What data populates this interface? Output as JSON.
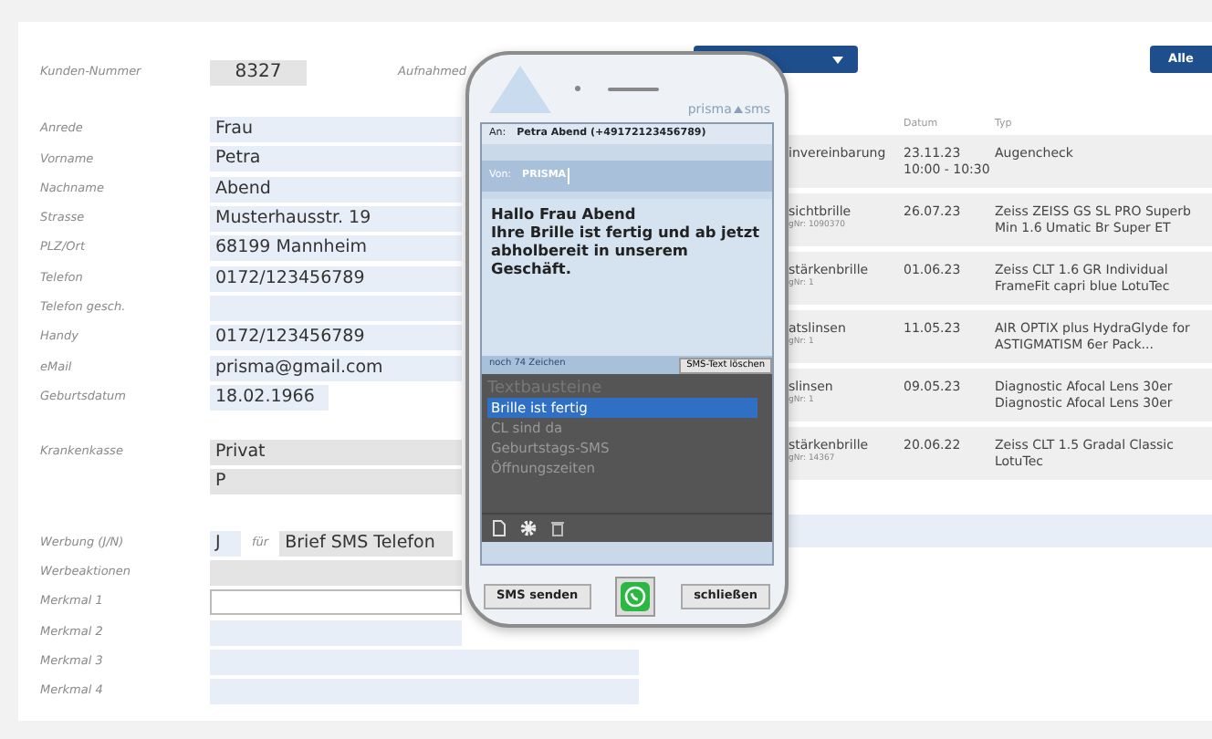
{
  "header": {
    "number_label": "Kunden-Nummer",
    "number": "8327",
    "intake_label": "Aufnahmed",
    "all_button": "Alle"
  },
  "form": {
    "groups": [
      [
        {
          "label": "Anrede",
          "value": "Frau",
          "kind": "text"
        },
        {
          "label": "Vorname",
          "value": "Petra",
          "kind": "text"
        },
        {
          "label": "Nachname",
          "value": "Abend",
          "kind": "text"
        },
        {
          "label": "Strasse",
          "value": "Musterhausstr. 19",
          "kind": "text"
        },
        {
          "label": "PLZ/Ort",
          "value": "68199 Mannheim",
          "kind": "text"
        },
        {
          "label": "Telefon",
          "value": "0172/123456789",
          "kind": "text"
        },
        {
          "label": "Telefon gesch.",
          "kind": "text"
        },
        {
          "label": "Handy",
          "value": "0172/123456789",
          "kind": "text"
        },
        {
          "label": "eMail",
          "value": "prisma@gmail.com",
          "kind": "text"
        },
        {
          "label": "Geburtsdatum",
          "value": "18.02.1966",
          "kind": "short"
        }
      ],
      [
        {
          "label": "Krankenkasse",
          "value": "Privat",
          "kind": "readonly"
        },
        {
          "value": "P",
          "kind": "readonly"
        }
      ],
      [
        {
          "label": "Werbung (J/N)",
          "value": "J",
          "kind": "optin",
          "for_label": "für",
          "channels": "Brief SMS Telefon"
        },
        {
          "label": "Werbeaktionen",
          "kind": "readonly"
        },
        {
          "label": "Merkmal 1",
          "kind": "input"
        },
        {
          "label": "Merkmal 2",
          "kind": "text"
        },
        {
          "label": "Merkmal 3",
          "kind": "long"
        },
        {
          "label": "Merkmal 4",
          "kind": "long"
        }
      ]
    ]
  },
  "table": {
    "columns": [
      "Datum",
      "Typ"
    ],
    "rows": [
      {
        "column_1": "invereinbarung",
        "date": "23.11.23",
        "time": "10:00 - 10:30",
        "type": "Augencheck"
      },
      {
        "column_1": "sichtbrille",
        "sub": "gNr: 1090370",
        "date": "26.07.23",
        "type": "Zeiss ZEISS GS SL PRO Superb Min 1.6 Umatic Br Super ET"
      },
      {
        "column_1": "stärkenbrille",
        "sub": "gNr: 1",
        "date": "01.06.23",
        "type": "Zeiss CLT 1.6 GR Individual FrameFit capri blue LotuTec"
      },
      {
        "column_1": "atslinsen",
        "sub": "gNr: 1",
        "date": "11.05.23",
        "type": "AIR OPTIX plus HydraGlyde for ASTIGMATISM 6er Pack..."
      },
      {
        "column_1": "slinsen",
        "sub": "gNr: 1",
        "date": "09.05.23",
        "type": "Diagnostic Afocal Lens 30er Diagnostic Afocal Lens 30er"
      },
      {
        "column_1": "stärkenbrille",
        "sub": "gNr: 14367",
        "date": "20.06.22",
        "type": "Zeiss CLT 1.5 Gradal Classic LotuTec"
      }
    ]
  },
  "phone": {
    "brand": "prisma",
    "brand_suffix": "sms",
    "to_label": "An:",
    "to": "Petra Abend (+49172123456789)",
    "from_label": "Von:",
    "from": "PRISMA",
    "message": "Hallo Frau Abend\nIhre Brille ist fertig und ab jetzt abholbereit in unserem Geschäft.",
    "chars_left": "noch 74 Zeichen",
    "clear_button": "SMS-Text löschen",
    "snippets_title": "Textbausteine",
    "snippets": [
      {
        "label": "Brille ist fertig",
        "selected": true
      },
      {
        "label": "CL sind da",
        "selected": false
      },
      {
        "label": "Geburtstags-SMS",
        "selected": false
      },
      {
        "label": "Öffnungszeiten",
        "selected": false
      }
    ],
    "send_button": "SMS senden",
    "close_button": "schließen"
  }
}
